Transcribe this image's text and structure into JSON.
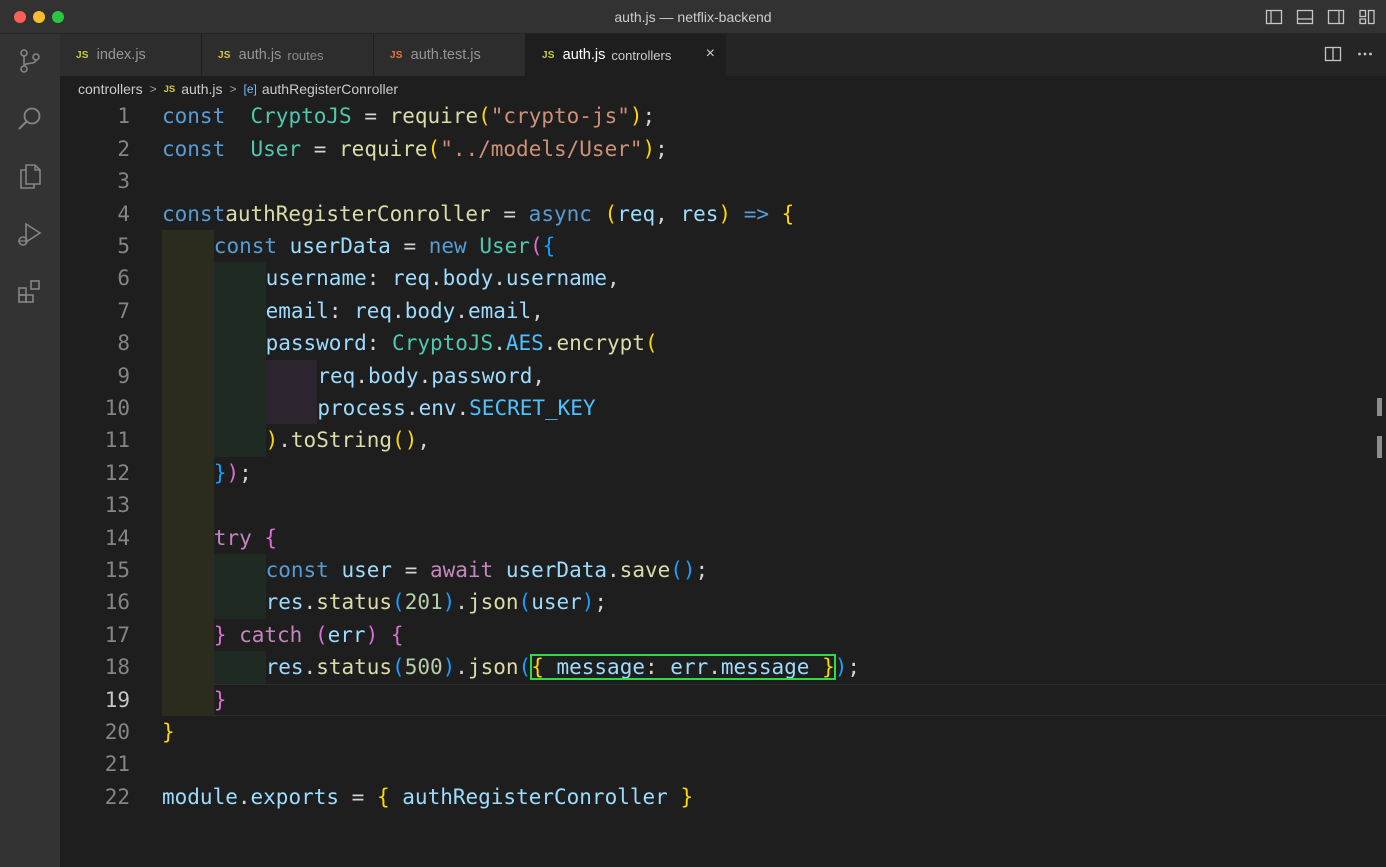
{
  "window": {
    "title": "auth.js — netflix-backend"
  },
  "colors": {
    "accent": "#007acc",
    "selection_box": "#2fd94a"
  },
  "activity_bar": [
    "source-control-icon",
    "search-icon",
    "explorer-icon",
    "run-debug-icon",
    "extensions-icon"
  ],
  "tabs": [
    {
      "badge": "JS",
      "label": "index.js",
      "desc": "",
      "badge_color": "#cbcb41"
    },
    {
      "badge": "JS",
      "label": "auth.js",
      "desc": "routes",
      "badge_color": "#cbcb41"
    },
    {
      "badge": "JS",
      "label": "auth.test.js",
      "desc": "",
      "badge_color": "#e37933"
    },
    {
      "badge": "JS",
      "label": "auth.js",
      "desc": "controllers",
      "badge_color": "#cbcb41",
      "active": true,
      "close": "×"
    }
  ],
  "breadcrumb": {
    "folder": "controllers",
    "file_badge": "JS",
    "file": "auth.js",
    "symbol_icon": "[e]",
    "symbol": "authRegisterConroller"
  },
  "editor": {
    "active_line": 19,
    "lines": [
      {
        "n": "1",
        "tokens": [
          [
            "kw",
            "const"
          ],
          [
            "",
            "  "
          ],
          [
            "cls",
            "CryptoJS"
          ],
          [
            "",
            " = "
          ],
          [
            "fn",
            "require"
          ],
          [
            "p1",
            "("
          ],
          [
            "str",
            "\"crypto-js\""
          ],
          [
            "p1",
            ")"
          ],
          [
            "",
            ";"
          ]
        ]
      },
      {
        "n": "2",
        "tokens": [
          [
            "kw",
            "const"
          ],
          [
            "",
            "  "
          ],
          [
            "cls",
            "User"
          ],
          [
            "",
            " = "
          ],
          [
            "fn",
            "require"
          ],
          [
            "p1",
            "("
          ],
          [
            "str",
            "\"../models/User\""
          ],
          [
            "p1",
            ")"
          ],
          [
            "",
            ";"
          ]
        ]
      },
      {
        "n": "3",
        "tokens": []
      },
      {
        "n": "4",
        "tokens": [
          [
            "kw",
            "const"
          ],
          [
            "",
            ""
          ],
          [
            "fn",
            "authRegisterConroller"
          ],
          [
            "",
            " = "
          ],
          [
            "kw",
            "async"
          ],
          [
            "",
            " "
          ],
          [
            "p1",
            "("
          ],
          [
            "var",
            "req"
          ],
          [
            "",
            ", "
          ],
          [
            "var",
            "res"
          ],
          [
            "p1",
            ")"
          ],
          [
            "",
            " "
          ],
          [
            "kw",
            "=>"
          ],
          [
            "",
            " "
          ],
          [
            "p1",
            "{"
          ]
        ]
      },
      {
        "n": "5",
        "tokens": [
          [
            "kw",
            "const"
          ],
          [
            "",
            " "
          ],
          [
            "var",
            "userData"
          ],
          [
            "",
            " = "
          ],
          [
            "kw",
            "new"
          ],
          [
            "",
            " "
          ],
          [
            "cls",
            "User"
          ],
          [
            "p2",
            "("
          ],
          [
            "p3",
            "{"
          ]
        ]
      },
      {
        "n": "6",
        "tokens": [
          [
            "var",
            "username"
          ],
          [
            "",
            ": "
          ],
          [
            "var",
            "req"
          ],
          [
            "",
            "."
          ],
          [
            "var",
            "body"
          ],
          [
            "",
            "."
          ],
          [
            "var",
            "username"
          ],
          [
            "",
            ","
          ]
        ]
      },
      {
        "n": "7",
        "tokens": [
          [
            "var",
            "email"
          ],
          [
            "",
            ": "
          ],
          [
            "var",
            "req"
          ],
          [
            "",
            "."
          ],
          [
            "var",
            "body"
          ],
          [
            "",
            "."
          ],
          [
            "var",
            "email"
          ],
          [
            "",
            ","
          ]
        ]
      },
      {
        "n": "8",
        "tokens": [
          [
            "var",
            "password"
          ],
          [
            "",
            ": "
          ],
          [
            "cls",
            "CryptoJS"
          ],
          [
            "",
            "."
          ],
          [
            "const",
            "AES"
          ],
          [
            "",
            "."
          ],
          [
            "fn",
            "encrypt"
          ],
          [
            "p1",
            "("
          ]
        ]
      },
      {
        "n": "9",
        "tokens": [
          [
            "var",
            "req"
          ],
          [
            "",
            "."
          ],
          [
            "var",
            "body"
          ],
          [
            "",
            "."
          ],
          [
            "var",
            "password"
          ],
          [
            "",
            ","
          ]
        ]
      },
      {
        "n": "10",
        "tokens": [
          [
            "var",
            "process"
          ],
          [
            "",
            "."
          ],
          [
            "var",
            "env"
          ],
          [
            "",
            "."
          ],
          [
            "const",
            "SECRET_KEY"
          ]
        ]
      },
      {
        "n": "11",
        "tokens": [
          [
            "p1",
            ")"
          ],
          [
            "",
            "."
          ],
          [
            "fn",
            "toString"
          ],
          [
            "p1",
            "()"
          ],
          [
            "",
            ","
          ]
        ]
      },
      {
        "n": "12",
        "tokens": [
          [
            "p3",
            "}"
          ],
          [
            "p2",
            ")"
          ],
          [
            "",
            ";"
          ]
        ]
      },
      {
        "n": "13",
        "tokens": []
      },
      {
        "n": "14",
        "tokens": [
          [
            "ctl",
            "try"
          ],
          [
            "",
            " "
          ],
          [
            "p2",
            "{"
          ]
        ]
      },
      {
        "n": "15",
        "tokens": [
          [
            "kw",
            "const"
          ],
          [
            "",
            " "
          ],
          [
            "var",
            "user"
          ],
          [
            "",
            " = "
          ],
          [
            "ctl",
            "await"
          ],
          [
            "",
            " "
          ],
          [
            "var",
            "userData"
          ],
          [
            "",
            "."
          ],
          [
            "fn",
            "save"
          ],
          [
            "p3",
            "()"
          ],
          [
            "",
            ";"
          ]
        ]
      },
      {
        "n": "16",
        "tokens": [
          [
            "var",
            "res"
          ],
          [
            "",
            "."
          ],
          [
            "fn",
            "status"
          ],
          [
            "p3",
            "("
          ],
          [
            "num",
            "201"
          ],
          [
            "p3",
            ")"
          ],
          [
            "",
            "."
          ],
          [
            "fn",
            "json"
          ],
          [
            "p3",
            "("
          ],
          [
            "var",
            "user"
          ],
          [
            "p3",
            ")"
          ],
          [
            "",
            ";"
          ]
        ]
      },
      {
        "n": "17",
        "tokens": [
          [
            "p2",
            "}"
          ],
          [
            "",
            " "
          ],
          [
            "ctl",
            "catch"
          ],
          [
            "",
            " "
          ],
          [
            "p2",
            "("
          ],
          [
            "var",
            "err"
          ],
          [
            "p2",
            ")"
          ],
          [
            "",
            " "
          ],
          [
            "p2",
            "{"
          ]
        ]
      },
      {
        "n": "18",
        "tokens": [
          [
            "var",
            "res"
          ],
          [
            "",
            "."
          ],
          [
            "fn",
            "status"
          ],
          [
            "p3",
            "("
          ],
          [
            "num",
            "500"
          ],
          [
            "p3",
            ")"
          ],
          [
            "",
            "."
          ],
          [
            "fn",
            "json"
          ],
          [
            "p3",
            "("
          ],
          [
            "box_p1",
            "{"
          ],
          [
            "box_var",
            " message"
          ],
          [
            "box",
            ": "
          ],
          [
            "box_var",
            "err"
          ],
          [
            "box",
            "."
          ],
          [
            "box_var",
            "message"
          ],
          [
            "box",
            " "
          ],
          [
            "box_p1",
            "}"
          ],
          [
            "p3",
            ")"
          ],
          [
            "",
            ";"
          ]
        ]
      },
      {
        "n": "19",
        "tokens": [
          [
            "p2",
            "}"
          ]
        ]
      },
      {
        "n": "20",
        "tokens": [
          [
            "p1",
            "}"
          ]
        ]
      },
      {
        "n": "21",
        "tokens": []
      },
      {
        "n": "22",
        "tokens": [
          [
            "var",
            "module"
          ],
          [
            "",
            "."
          ],
          [
            "var",
            "exports"
          ],
          [
            "",
            " = "
          ],
          [
            "p1",
            "{"
          ],
          [
            "",
            " "
          ],
          [
            "var",
            "authRegisterConroller"
          ],
          [
            "",
            " "
          ],
          [
            "p1",
            "}"
          ]
        ]
      }
    ]
  }
}
